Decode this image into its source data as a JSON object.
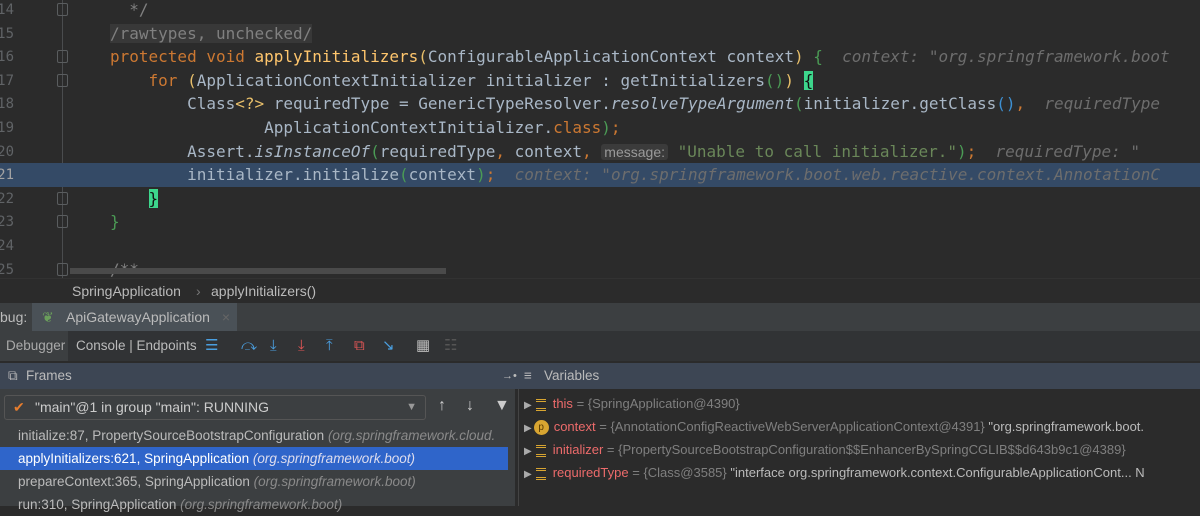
{
  "editor": {
    "lines": [
      {
        "n": "14",
        "fold": true,
        "segs": [
          [
            "  */",
            "cm"
          ]
        ]
      },
      {
        "n": "15",
        "segs": [
          [
            "/rawtypes, unchecked/",
            "ann"
          ]
        ]
      },
      {
        "n": "16",
        "fold": true,
        "segs": [
          [
            "protected ",
            "kw"
          ],
          [
            "void ",
            "kw"
          ],
          [
            "applyInitializers",
            "fn"
          ],
          [
            "(",
            "par"
          ],
          [
            "ConfigurableApplicationContext context",
            "tx"
          ],
          [
            ")",
            "par"
          ],
          [
            " {",
            "par2"
          ],
          [
            "  context: \"org.springframework.boot",
            "hint"
          ]
        ]
      },
      {
        "n": "17",
        "fold": true,
        "segs": [
          [
            "    for ",
            "kw"
          ],
          [
            "(",
            "par"
          ],
          [
            "ApplicationContextInitializer initializer : getInitializers",
            "tx"
          ],
          [
            "()",
            "par2"
          ],
          [
            ")",
            "par"
          ],
          [
            " ",
            "tx"
          ],
          [
            "{",
            "brace"
          ]
        ]
      },
      {
        "n": "18",
        "segs": [
          [
            "        Class",
            "tx"
          ],
          [
            "<?>",
            "par"
          ],
          [
            " requiredType = GenericTypeResolver.",
            "tx"
          ],
          [
            "resolveTypeArgument",
            "it"
          ],
          [
            "(",
            "par2"
          ],
          [
            "initializer.getClass",
            "tx"
          ],
          [
            "()",
            "par3"
          ],
          [
            ",",
            "kw"
          ],
          [
            "  requiredType",
            "hint"
          ]
        ]
      },
      {
        "n": "19",
        "segs": [
          [
            "                ApplicationContextInitializer.",
            "tx"
          ],
          [
            "class",
            "kw"
          ],
          [
            ")",
            "par2"
          ],
          [
            ";",
            "kw"
          ]
        ]
      },
      {
        "n": "20",
        "segs": [
          [
            "        Assert.",
            "tx"
          ],
          [
            "isInstanceOf",
            "it"
          ],
          [
            "(",
            "par2"
          ],
          [
            "requiredType",
            "tx"
          ],
          [
            ", ",
            "kw"
          ],
          [
            "context",
            "tx"
          ],
          [
            ", ",
            "kw"
          ],
          [
            "message:",
            "lbl"
          ],
          [
            " \"Unable to call initializer.\"",
            "str"
          ],
          [
            ")",
            "par2"
          ],
          [
            ";",
            "kw"
          ],
          [
            "  requiredType: \"",
            "hint"
          ]
        ]
      },
      {
        "n": "21",
        "cur": true,
        "segs": [
          [
            "        initializer.initialize",
            "tx"
          ],
          [
            "(",
            "par2"
          ],
          [
            "context",
            "tx"
          ],
          [
            ")",
            "par2"
          ],
          [
            ";",
            "kw"
          ],
          [
            "  context: \"org.springframework.boot.web.reactive.context.AnnotationC",
            "hint"
          ]
        ]
      },
      {
        "n": "22",
        "fold": true,
        "segs": [
          [
            "    ",
            "tx"
          ],
          [
            "}",
            "brace"
          ]
        ]
      },
      {
        "n": "23",
        "fold": true,
        "segs": [
          [
            "}",
            "par2"
          ]
        ]
      },
      {
        "n": "24",
        "segs": []
      },
      {
        "n": "25",
        "fold": true,
        "segs": [
          [
            "/**",
            "cm"
          ]
        ]
      }
    ]
  },
  "breadcrumb": [
    "SpringApplication",
    "applyInitializers()"
  ],
  "debug": {
    "label": "bug:",
    "tab": "ApiGatewayApplication",
    "close": "×"
  },
  "toolbar": {
    "debugger": "Debugger",
    "console": "Console | Endpoints"
  },
  "frames": {
    "title": "Frames",
    "thread": "\"main\"@1 in group \"main\": RUNNING",
    "rows": [
      {
        "m": "initialize:87, PropertySourceBootstrapConfiguration",
        "p": "(org.springframework.cloud."
      },
      {
        "m": "applyInitializers:621, SpringApplication",
        "p": "(org.springframework.boot)",
        "sel": true
      },
      {
        "m": "prepareContext:365, SpringApplication",
        "p": "(org.springframework.boot)"
      },
      {
        "m": "run:310, SpringApplication",
        "p": "(org.springframework.boot)"
      }
    ]
  },
  "variables": {
    "title": "Variables",
    "rows": [
      {
        "name": "this",
        "type": "{SpringApplication@4390}",
        "val": "",
        "icon": "field"
      },
      {
        "name": "context",
        "type": "{AnnotationConfigReactiveWebServerApplicationContext@4391}",
        "val": "\"org.springframework.boot.",
        "icon": "param"
      },
      {
        "name": "initializer",
        "type": "{PropertySourceBootstrapConfiguration$$EnhancerBySpringCGLIB$$d643b9c1@4389}",
        "val": "",
        "icon": "field"
      },
      {
        "name": "requiredType",
        "type": "{Class@3585}",
        "val": "\"interface org.springframework.context.ConfigurableApplicationCont... N",
        "icon": "field"
      }
    ]
  }
}
